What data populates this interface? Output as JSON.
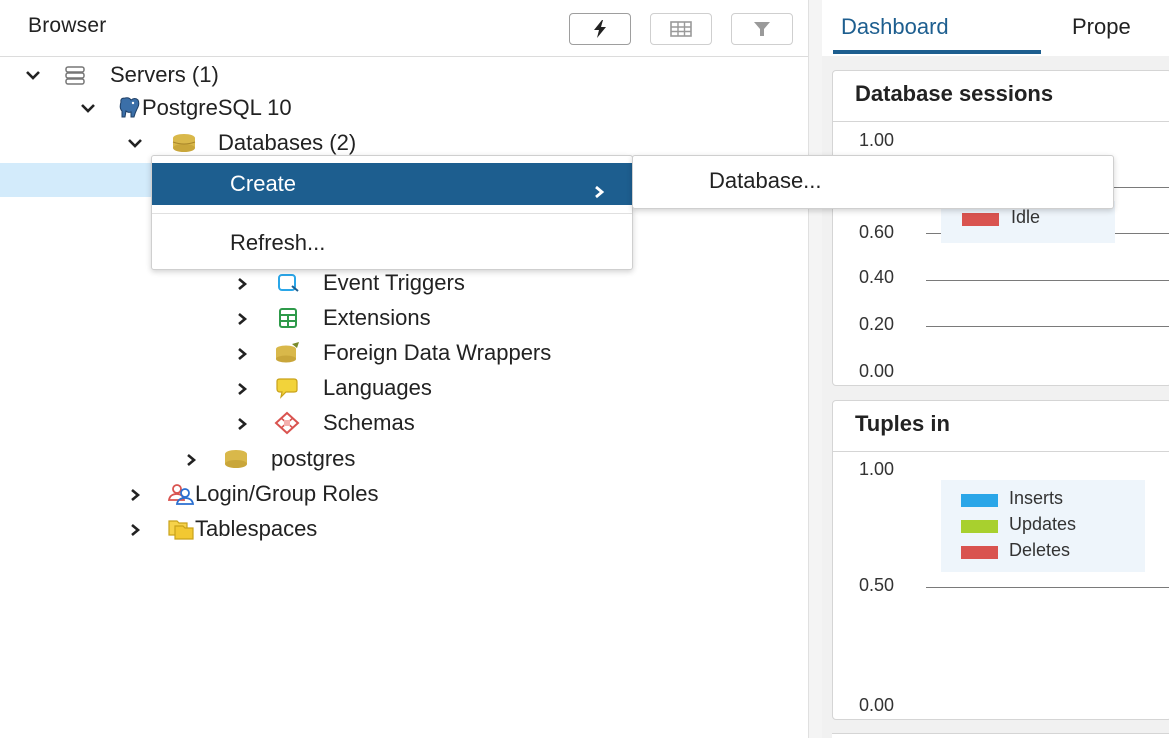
{
  "browser": {
    "title": "Browser",
    "toolbar": {
      "query_tool_icon": "lightning-icon",
      "view_data_icon": "table-grid-icon",
      "filter_icon": "filter-icon"
    },
    "tree": [
      {
        "label": "Servers (1)",
        "icon": "servers-icon",
        "expanded": true
      },
      {
        "label": "PostgreSQL 10",
        "icon": "postgresql-elephant-icon",
        "expanded": true
      },
      {
        "label": "Databases (2)",
        "icon": "databases-icon",
        "expanded": true
      },
      {
        "label": "Event Triggers",
        "icon": "event-trigger-icon",
        "expanded": false
      },
      {
        "label": "Extensions",
        "icon": "extensions-icon",
        "expanded": false
      },
      {
        "label": "Foreign Data Wrappers",
        "icon": "foreign-data-wrapper-icon",
        "expanded": false
      },
      {
        "label": "Languages",
        "icon": "languages-icon",
        "expanded": false
      },
      {
        "label": "Schemas",
        "icon": "schemas-icon",
        "expanded": false
      },
      {
        "label": "postgres",
        "icon": "database-icon",
        "expanded": false
      },
      {
        "label": "Login/Group Roles",
        "icon": "roles-icon",
        "expanded": false
      },
      {
        "label": "Tablespaces",
        "icon": "tablespaces-icon",
        "expanded": false
      }
    ]
  },
  "context_menu": {
    "create_label": "Create",
    "refresh_label": "Refresh...",
    "submenu_item": "Database..."
  },
  "dashboard": {
    "tabs": [
      "Dashboard",
      "Prope"
    ],
    "active_tab": "Dashboard",
    "cards": [
      {
        "title": "Database sessions",
        "ticks": [
          "1.00",
          "0.60",
          "0.40",
          "0.20",
          "0.00"
        ],
        "legend": [
          {
            "name": "Idle",
            "color": "#d9534f"
          }
        ]
      },
      {
        "title": "Tuples in",
        "ticks": [
          "1.00",
          "0.50",
          "0.00"
        ],
        "legend": [
          {
            "name": "Inserts",
            "color": "#2aa6e8"
          },
          {
            "name": "Updates",
            "color": "#a8d02e"
          },
          {
            "name": "Deletes",
            "color": "#d9534f"
          }
        ]
      }
    ]
  },
  "colors": {
    "accent": "#1d5e8f",
    "selection": "#d3ebfb"
  }
}
